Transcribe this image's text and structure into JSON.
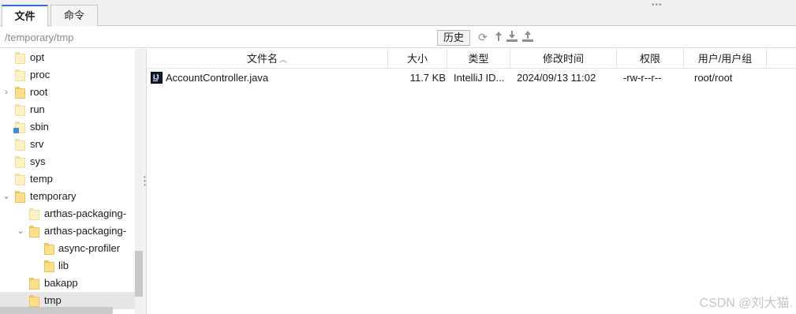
{
  "tabs": [
    {
      "label": "文件",
      "active": true
    },
    {
      "label": "命令",
      "active": false
    }
  ],
  "pathbar": {
    "path": "/temporary/tmp",
    "history_label": "历史",
    "icons": [
      "refresh-icon",
      "go-up-icon",
      "download-icon",
      "upload-icon"
    ]
  },
  "tree": {
    "items": [
      {
        "label": "opt"
      },
      {
        "label": "proc"
      },
      {
        "label": "root"
      },
      {
        "label": "run"
      },
      {
        "label": "sbin"
      },
      {
        "label": "srv"
      },
      {
        "label": "sys"
      },
      {
        "label": "temp"
      },
      {
        "label": "temporary"
      },
      {
        "label": "arthas-packaging-"
      },
      {
        "label": "arthas-packaging-"
      },
      {
        "label": "async-profiler"
      },
      {
        "label": "lib"
      },
      {
        "label": "bakapp"
      },
      {
        "label": "tmp"
      }
    ]
  },
  "table": {
    "columns": {
      "name": "文件名",
      "size": "大小",
      "type": "类型",
      "modified": "修改时间",
      "permissions": "权限",
      "owner": "用户/用户组"
    },
    "rows": [
      {
        "name": "AccountController.java",
        "size": "11.7 KB",
        "type": "IntelliJ ID...",
        "modified": "2024/09/13 11:02",
        "permissions": "-rw-r--r--",
        "owner": "root/root"
      }
    ]
  },
  "watermark": "CSDN @刘大猫."
}
